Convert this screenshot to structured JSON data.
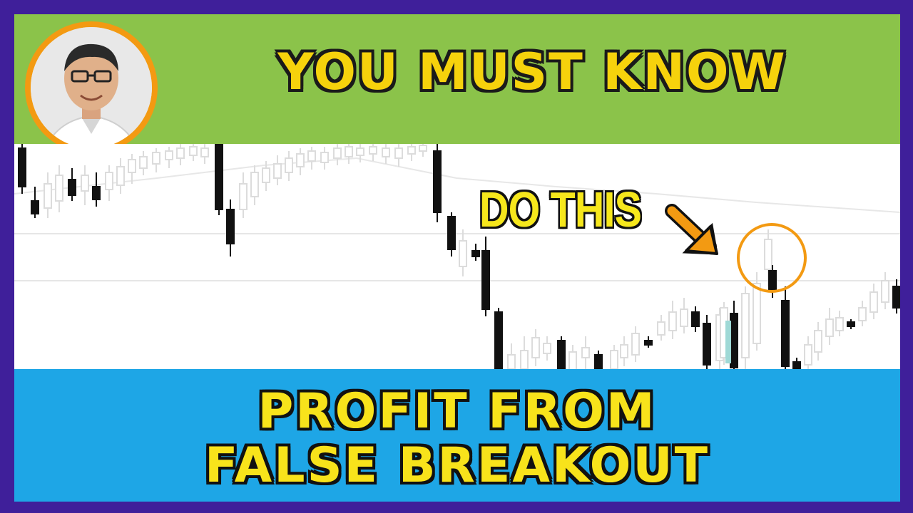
{
  "thumbnail": {
    "headline": "YOU MUST KNOW",
    "annotation": "DO THIS",
    "subtitle_line1": "PROFIT FROM",
    "subtitle_line2": "FALSE BREAKOUT",
    "avatar_icon": "presenter-photo",
    "arrow_icon": "arrow-down-right-icon",
    "highlight_icon": "circle-highlight-icon"
  },
  "colors": {
    "frame": "#3f1f9a",
    "top_band": "#8bc34a",
    "bottom_band": "#1ea6e6",
    "headline_text": "#f6d20c",
    "subtitle_text": "#f8e31b",
    "accent_orange": "#f39a12",
    "candle_dark": "#111111",
    "candle_faded": "#d9d9d9"
  }
}
